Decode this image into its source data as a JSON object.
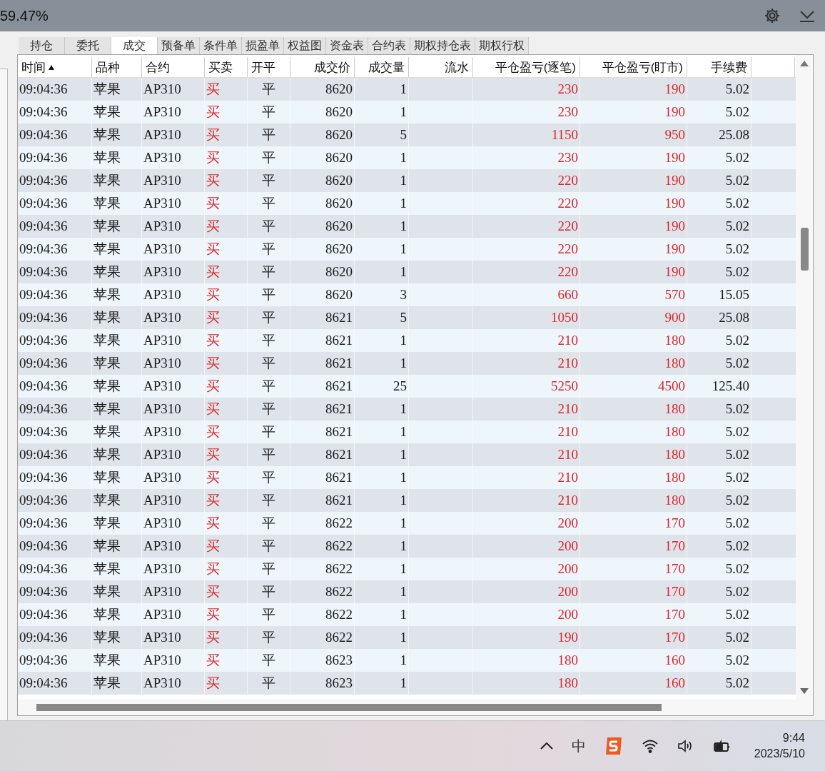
{
  "top_bar": {
    "value": "59.47%"
  },
  "tabs": [
    {
      "label": "持仓",
      "selected": false
    },
    {
      "label": "委托",
      "selected": false
    },
    {
      "label": "成交",
      "selected": true
    },
    {
      "label": "预备单",
      "selected": false
    },
    {
      "label": "条件单",
      "selected": false
    },
    {
      "label": "损盈单",
      "selected": false
    },
    {
      "label": "权益图",
      "selected": false
    },
    {
      "label": "资金表",
      "selected": false
    },
    {
      "label": "合约表",
      "selected": false
    },
    {
      "label": "期权持仓表",
      "selected": false
    },
    {
      "label": "期权行权",
      "selected": false
    }
  ],
  "table": {
    "columns": [
      {
        "label": "时间",
        "sorted": true
      },
      {
        "label": "品种",
        "sorted": false
      },
      {
        "label": "合约",
        "sorted": false
      },
      {
        "label": "买卖",
        "sorted": false
      },
      {
        "label": "开平",
        "sorted": false
      },
      {
        "label": "成交价",
        "sorted": false
      },
      {
        "label": "成交量",
        "sorted": false
      },
      {
        "label": "流水",
        "sorted": false
      },
      {
        "label": "平仓盈亏(逐笔)",
        "sorted": false
      },
      {
        "label": "平仓盈亏(盯市)",
        "sorted": false
      },
      {
        "label": "手续费",
        "sorted": false
      }
    ],
    "rows": [
      [
        "09:04:36",
        "苹果",
        "AP310",
        "买",
        "平",
        "8620",
        "1",
        "",
        "230",
        "190",
        "5.02"
      ],
      [
        "09:04:36",
        "苹果",
        "AP310",
        "买",
        "平",
        "8620",
        "1",
        "",
        "230",
        "190",
        "5.02"
      ],
      [
        "09:04:36",
        "苹果",
        "AP310",
        "买",
        "平",
        "8620",
        "5",
        "",
        "1150",
        "950",
        "25.08"
      ],
      [
        "09:04:36",
        "苹果",
        "AP310",
        "买",
        "平",
        "8620",
        "1",
        "",
        "230",
        "190",
        "5.02"
      ],
      [
        "09:04:36",
        "苹果",
        "AP310",
        "买",
        "平",
        "8620",
        "1",
        "",
        "220",
        "190",
        "5.02"
      ],
      [
        "09:04:36",
        "苹果",
        "AP310",
        "买",
        "平",
        "8620",
        "1",
        "",
        "220",
        "190",
        "5.02"
      ],
      [
        "09:04:36",
        "苹果",
        "AP310",
        "买",
        "平",
        "8620",
        "1",
        "",
        "220",
        "190",
        "5.02"
      ],
      [
        "09:04:36",
        "苹果",
        "AP310",
        "买",
        "平",
        "8620",
        "1",
        "",
        "220",
        "190",
        "5.02"
      ],
      [
        "09:04:36",
        "苹果",
        "AP310",
        "买",
        "平",
        "8620",
        "1",
        "",
        "220",
        "190",
        "5.02"
      ],
      [
        "09:04:36",
        "苹果",
        "AP310",
        "买",
        "平",
        "8620",
        "3",
        "",
        "660",
        "570",
        "15.05"
      ],
      [
        "09:04:36",
        "苹果",
        "AP310",
        "买",
        "平",
        "8621",
        "5",
        "",
        "1050",
        "900",
        "25.08"
      ],
      [
        "09:04:36",
        "苹果",
        "AP310",
        "买",
        "平",
        "8621",
        "1",
        "",
        "210",
        "180",
        "5.02"
      ],
      [
        "09:04:36",
        "苹果",
        "AP310",
        "买",
        "平",
        "8621",
        "1",
        "",
        "210",
        "180",
        "5.02"
      ],
      [
        "09:04:36",
        "苹果",
        "AP310",
        "买",
        "平",
        "8621",
        "25",
        "",
        "5250",
        "4500",
        "125.40"
      ],
      [
        "09:04:36",
        "苹果",
        "AP310",
        "买",
        "平",
        "8621",
        "1",
        "",
        "210",
        "180",
        "5.02"
      ],
      [
        "09:04:36",
        "苹果",
        "AP310",
        "买",
        "平",
        "8621",
        "1",
        "",
        "210",
        "180",
        "5.02"
      ],
      [
        "09:04:36",
        "苹果",
        "AP310",
        "买",
        "平",
        "8621",
        "1",
        "",
        "210",
        "180",
        "5.02"
      ],
      [
        "09:04:36",
        "苹果",
        "AP310",
        "买",
        "平",
        "8621",
        "1",
        "",
        "210",
        "180",
        "5.02"
      ],
      [
        "09:04:36",
        "苹果",
        "AP310",
        "买",
        "平",
        "8621",
        "1",
        "",
        "210",
        "180",
        "5.02"
      ],
      [
        "09:04:36",
        "苹果",
        "AP310",
        "买",
        "平",
        "8622",
        "1",
        "",
        "200",
        "170",
        "5.02"
      ],
      [
        "09:04:36",
        "苹果",
        "AP310",
        "买",
        "平",
        "8622",
        "1",
        "",
        "200",
        "170",
        "5.02"
      ],
      [
        "09:04:36",
        "苹果",
        "AP310",
        "买",
        "平",
        "8622",
        "1",
        "",
        "200",
        "170",
        "5.02"
      ],
      [
        "09:04:36",
        "苹果",
        "AP310",
        "买",
        "平",
        "8622",
        "1",
        "",
        "200",
        "170",
        "5.02"
      ],
      [
        "09:04:36",
        "苹果",
        "AP310",
        "买",
        "平",
        "8622",
        "1",
        "",
        "200",
        "170",
        "5.02"
      ],
      [
        "09:04:36",
        "苹果",
        "AP310",
        "买",
        "平",
        "8622",
        "1",
        "",
        "190",
        "170",
        "5.02"
      ],
      [
        "09:04:36",
        "苹果",
        "AP310",
        "买",
        "平",
        "8623",
        "1",
        "",
        "180",
        "160",
        "5.02"
      ],
      [
        "09:04:36",
        "苹果",
        "AP310",
        "买",
        "平",
        "8623",
        "1",
        "",
        "180",
        "160",
        "5.02"
      ]
    ]
  },
  "taskbar": {
    "ime": "中",
    "time": "9:44",
    "date": "2023/5/10"
  }
}
